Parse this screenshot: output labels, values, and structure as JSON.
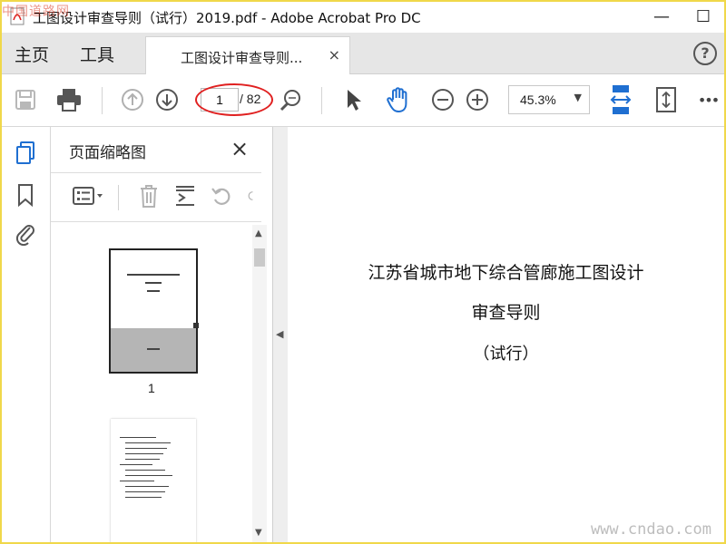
{
  "window": {
    "title": "工图设计审查导则（试行）2019.pdf - Adobe Acrobat Pro DC",
    "minimize": "—",
    "maximize": "☐"
  },
  "menu": {
    "home": "主页",
    "tools": "工具",
    "doc_tab": "工图设计审查导则...",
    "doc_tab_close": "×",
    "help": "?"
  },
  "toolbar": {
    "current_page": "1",
    "total_pages": "/ 82",
    "zoom": "45.3%",
    "more": "•••",
    "icons": [
      "save-icon",
      "print-icon",
      "page-up-icon",
      "page-down-icon",
      "zoom-search-icon",
      "select-cursor-icon",
      "hand-tool-icon",
      "zoom-out-icon",
      "zoom-in-icon",
      "fit-page-icon",
      "scroll-mode-icon",
      "more-icon"
    ]
  },
  "panel": {
    "title": "页面缩略图",
    "close": "×",
    "thumbnails": [
      {
        "page_number": "1"
      }
    ]
  },
  "document": {
    "line1": "江苏省城市地下综合管廊施工图设计",
    "line2": "审查导则",
    "line3": "（试行）"
  },
  "watermark": {
    "top_left": "中国道路网",
    "bottom_right": "www.cndao.com"
  },
  "colors": {
    "accent_blue": "#1f6fd1",
    "annotation_red": "#e02020",
    "frame_yellow": "#f0d84a"
  }
}
